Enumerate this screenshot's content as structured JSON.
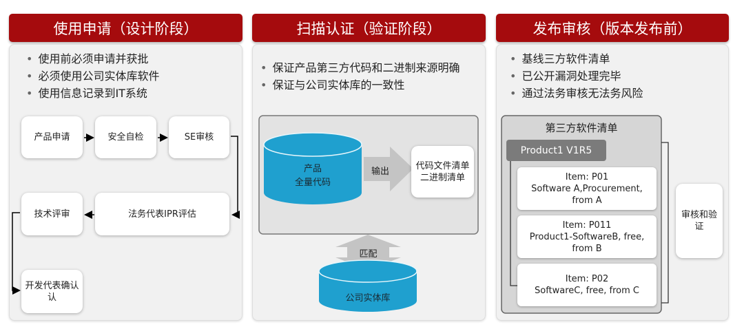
{
  "columns": [
    {
      "title": "使用申请（设计阶段）",
      "bullets": [
        "使用前必须申请并获批",
        "必须使用公司实体库软件",
        "使用信息记录到IT系统"
      ],
      "steps": [
        "产品申请",
        "安全自检",
        "SE审核",
        "法务代表IPR评估",
        "技术评审",
        "开发代表确认认"
      ]
    },
    {
      "title": "扫描认证（验证阶段）",
      "bullets": [
        "保证产品第三方代码和二进制来源明确",
        "保证与公司实体库的一致性"
      ],
      "source_db": [
        "产品",
        "全量代码"
      ],
      "output_arrow": "输出",
      "output_box": [
        "代码文件清单",
        "二进制清单"
      ],
      "match_arrow": "匹配",
      "company_db": "公司实体库"
    },
    {
      "title": "发布审核（版本发布前）",
      "bullets": [
        "基线三方软件清单",
        "已公开漏洞处理完毕",
        "通过法务审核无法务风险"
      ],
      "list_title": "第三方软件清单",
      "product": "Product1 V1R5",
      "items": [
        [
          "Item: P01",
          "Software A,Procurement,",
          "from A"
        ],
        [
          "Item: P011",
          "Product1-SoftwareB, free,",
          "from B"
        ],
        [
          "Item: P02",
          "SoftwareC, free, from C"
        ]
      ],
      "review": "审核和验证"
    }
  ],
  "colors": {
    "header": "#a50b0d",
    "cylinder": "#1fa0cf",
    "panel": "#f1f1f1"
  }
}
